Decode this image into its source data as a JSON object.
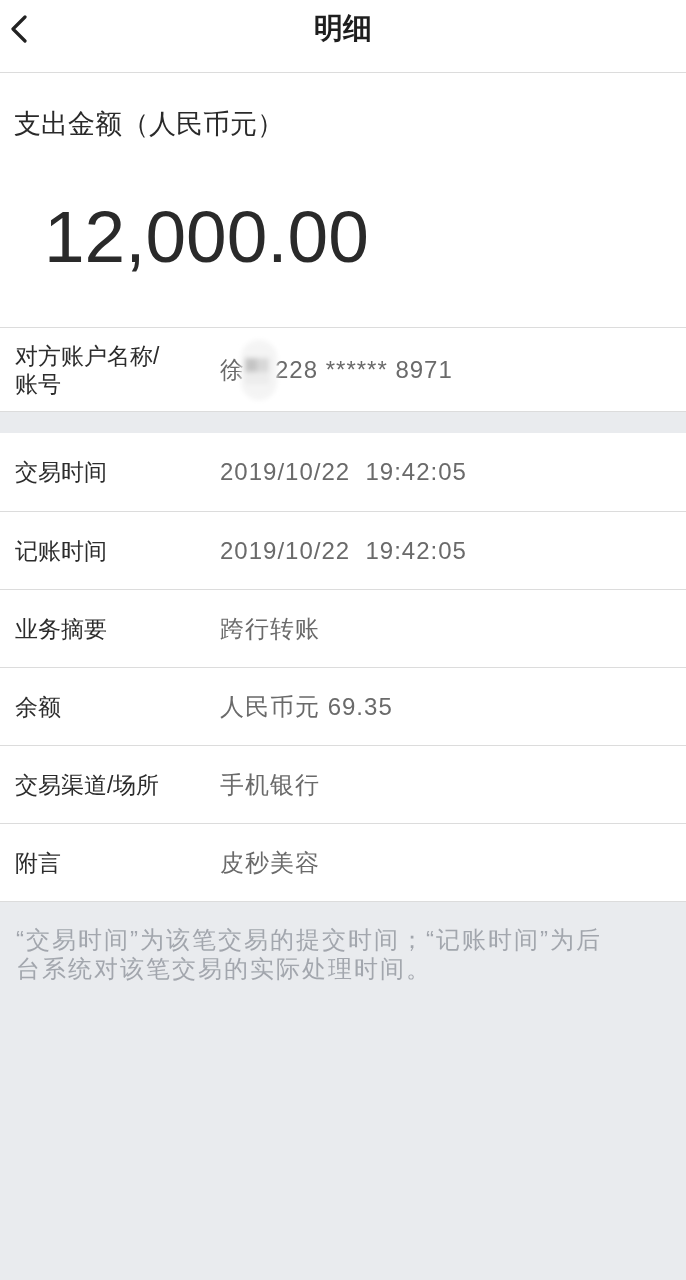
{
  "header": {
    "title": "明细"
  },
  "amount": {
    "label": "支出金额（人民币元）",
    "value": "12,000.00"
  },
  "counterparty": {
    "label": "对方账户名称/账号",
    "name": "徐",
    "redacted": true,
    "account": "228 ****** 8971"
  },
  "details": [
    {
      "label": "交易时间",
      "value": "2019/10/22  19:42:05"
    },
    {
      "label": "记账时间",
      "value": "2019/10/22  19:42:05"
    },
    {
      "label": "业务摘要",
      "value": "跨行转账"
    },
    {
      "label": "余额",
      "value": "人民币元 69.35"
    },
    {
      "label": "交易渠道/场所",
      "value": "手机银行"
    },
    {
      "label": "附言",
      "value": "皮秒美容"
    }
  ],
  "note": "“交易时间”为该笔交易的提交时间；“记账时间”为后台系统对该笔交易的实际处理时间。"
}
